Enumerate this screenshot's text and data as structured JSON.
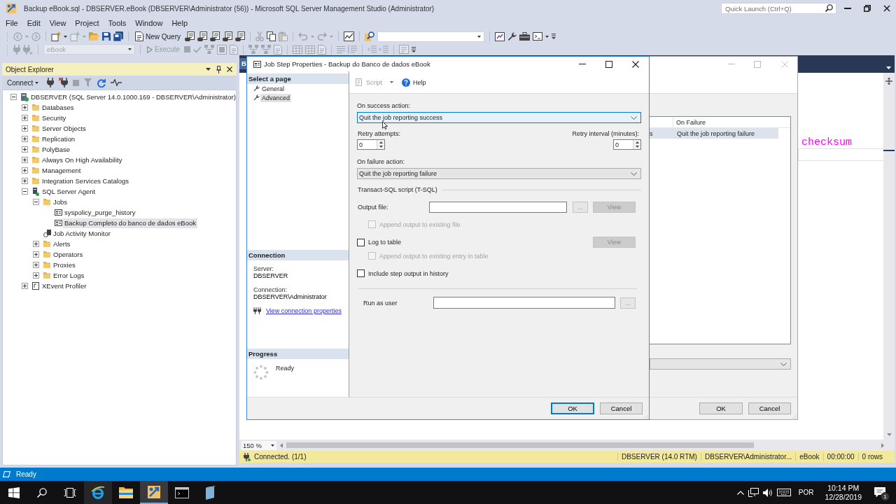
{
  "window": {
    "title": "Backup eBook.sql - DBSERVER.eBook (DBSERVER\\Administrator (56)) - Microsoft SQL Server Management Studio (Administrator)",
    "quick_launch": {
      "placeholder": "Quick Launch (Ctrl+Q)"
    }
  },
  "menu": [
    "File",
    "Edit",
    "View",
    "Project",
    "Tools",
    "Window",
    "Help"
  ],
  "toolbar_1": [
    {
      "kind": "back",
      "disabled": true
    },
    {
      "kind": "caret",
      "disabled": true
    },
    {
      "kind": "forward",
      "disabled": true
    },
    {
      "kind": "separator"
    },
    {
      "kind": "new_project",
      "disabled": false
    },
    {
      "kind": "caret",
      "disabled": false
    },
    {
      "kind": "add_item",
      "disabled": true
    },
    {
      "kind": "caret",
      "disabled": true
    },
    {
      "kind": "open",
      "disabled": false
    },
    {
      "kind": "save",
      "disabled": false
    },
    {
      "kind": "save_all",
      "disabled": false
    },
    {
      "kind": "separator"
    },
    {
      "kind": "new_query",
      "label": "New Query",
      "disabled": false
    },
    {
      "kind": "db_query",
      "disabled": false
    },
    {
      "kind": "db_query",
      "disabled": false
    },
    {
      "kind": "db_query",
      "disabled": false
    },
    {
      "kind": "db_query",
      "disabled": false
    },
    {
      "kind": "db_query",
      "disabled": false
    },
    {
      "kind": "separator"
    },
    {
      "kind": "cut",
      "disabled": true
    },
    {
      "kind": "copy",
      "disabled": false
    },
    {
      "kind": "paste",
      "disabled": true
    },
    {
      "kind": "separator"
    },
    {
      "kind": "undo",
      "disabled": true
    },
    {
      "kind": "caret",
      "disabled": true
    },
    {
      "kind": "redo",
      "disabled": true
    },
    {
      "kind": "caret",
      "disabled": true
    },
    {
      "kind": "separator"
    },
    {
      "kind": "activity",
      "disabled": false
    },
    {
      "kind": "separator"
    },
    {
      "kind": "find",
      "disabled": false
    },
    {
      "kind": "find_combo",
      "disabled": false
    },
    {
      "kind": "separator"
    },
    {
      "kind": "report",
      "disabled": false
    },
    {
      "kind": "wrench",
      "disabled": false
    },
    {
      "kind": "toolbox",
      "disabled": false
    },
    {
      "kind": "console",
      "disabled": false
    },
    {
      "kind": "caret",
      "disabled": false
    },
    {
      "kind": "overflow",
      "disabled": false
    }
  ],
  "toolbar_2": [
    {
      "kind": "plug",
      "disabled": true
    },
    {
      "kind": "plug_swap",
      "disabled": true
    },
    {
      "kind": "separator"
    },
    {
      "kind": "database_combo",
      "value": "eBook",
      "disabled": true
    },
    {
      "kind": "separator"
    },
    {
      "kind": "execute",
      "label": "Execute",
      "disabled": true
    },
    {
      "kind": "stop",
      "disabled": true
    },
    {
      "kind": "check",
      "disabled": true
    },
    {
      "kind": "plan",
      "disabled": true
    },
    {
      "kind": "query_box",
      "disabled": true
    },
    {
      "kind": "page",
      "disabled": true
    },
    {
      "kind": "separator"
    },
    {
      "kind": "plan",
      "disabled": true
    },
    {
      "kind": "plan",
      "disabled": true
    },
    {
      "kind": "page",
      "disabled": true
    },
    {
      "kind": "separator"
    },
    {
      "kind": "grid",
      "disabled": true
    },
    {
      "kind": "grid",
      "disabled": true
    },
    {
      "kind": "page",
      "disabled": true
    },
    {
      "kind": "separator"
    },
    {
      "kind": "lines",
      "disabled": true
    },
    {
      "kind": "comment",
      "disabled": true
    },
    {
      "kind": "separator"
    },
    {
      "kind": "outdent",
      "disabled": true
    },
    {
      "kind": "indent",
      "disabled": true
    },
    {
      "kind": "separator"
    },
    {
      "kind": "values",
      "disabled": true
    },
    {
      "kind": "overflow",
      "disabled": false
    }
  ],
  "object_explorer": {
    "title": "Object Explorer",
    "connect": "Connect",
    "toolbar": [
      {
        "kind": "plug",
        "disabled": false
      },
      {
        "kind": "plug_x",
        "disabled": false
      },
      {
        "kind": "stop",
        "disabled": true
      },
      {
        "kind": "filter",
        "disabled": true
      },
      {
        "kind": "refresh",
        "disabled": false
      },
      {
        "kind": "pulse",
        "disabled": false
      }
    ],
    "tree": [
      {
        "label": "DBSERVER (SQL Server 14.0.1000.169 - DBSERVER\\Administrator)",
        "kind": "server",
        "expanded": true,
        "selected": false,
        "children": [
          {
            "label": "Databases",
            "kind": "folder",
            "expanded": false,
            "selected": false
          },
          {
            "label": "Security",
            "kind": "folder",
            "expanded": false,
            "selected": false
          },
          {
            "label": "Server Objects",
            "kind": "folder",
            "expanded": false,
            "selected": false
          },
          {
            "label": "Replication",
            "kind": "folder",
            "expanded": false,
            "selected": false
          },
          {
            "label": "PolyBase",
            "kind": "folder",
            "expanded": false,
            "selected": false
          },
          {
            "label": "Always On High Availability",
            "kind": "folder",
            "expanded": false,
            "selected": false
          },
          {
            "label": "Management",
            "kind": "folder",
            "expanded": false,
            "selected": false
          },
          {
            "label": "Integration Services Catalogs",
            "kind": "folder",
            "expanded": false,
            "selected": false
          },
          {
            "label": "SQL Server Agent",
            "kind": "agent",
            "expanded": true,
            "selected": false,
            "children": [
              {
                "label": "Jobs",
                "kind": "folder",
                "expanded": true,
                "selected": false,
                "children": [
                  {
                    "label": "syspolicy_purge_history",
                    "kind": "job",
                    "selected": false
                  },
                  {
                    "label": "Backup Completo do banco de dados eBook",
                    "kind": "job",
                    "selected": true
                  }
                ]
              },
              {
                "label": "Job Activity Monitor",
                "kind": "monitor",
                "selected": false
              },
              {
                "label": "Alerts",
                "kind": "folder",
                "expanded": false,
                "selected": false
              },
              {
                "label": "Operators",
                "kind": "folder",
                "expanded": false,
                "selected": false
              },
              {
                "label": "Proxies",
                "kind": "folder",
                "expanded": false,
                "selected": false
              },
              {
                "label": "Error Logs",
                "kind": "folder",
                "expanded": false,
                "selected": false
              }
            ]
          },
          {
            "label": "XEvent Profiler",
            "kind": "profiler",
            "expanded": false,
            "selected": false
          }
        ]
      }
    ]
  },
  "editor": {
    "tab": "B",
    "code": "checksum",
    "zoom": "150 %",
    "status": {
      "message": "Connected. (1/1)",
      "fields": [
        "DBSERVER (14.0 RTM)",
        "DBSERVER\\Administrator...",
        "eBook",
        "00:00:00",
        "0 rows"
      ]
    }
  },
  "job_dialog": {
    "list": {
      "headings": {
        "on_failure": "On Failure"
      },
      "rows": [
        {
          "column_1": "s",
          "on_failure": "Quit the job reporting failure",
          "selected": true
        }
      ]
    },
    "buttons": [
      "OK",
      "Cancel"
    ]
  },
  "step_dialog": {
    "title": "Job Step Properties - Backup do Banco de dados eBook",
    "pages_header": "Select a page",
    "pages": [
      {
        "label": "General",
        "selected": false
      },
      {
        "label": "Advanced",
        "selected": true
      }
    ],
    "connection": {
      "header": "Connection",
      "server_label": "Server:",
      "server": "DBSERVER",
      "connection_label": "Connection:",
      "connection": "DBSERVER\\Administrator",
      "link": "View connection properties"
    },
    "progress": {
      "header": "Progress",
      "status": "Ready"
    },
    "toolbar": {
      "script": {
        "label": "Script",
        "disabled": true
      },
      "help": {
        "label": "Help",
        "disabled": false
      }
    },
    "on_success": {
      "label": "On success action:",
      "value": "Quit the job reporting success",
      "focused": true
    },
    "retry_attempts": {
      "label": "Retry attempts:",
      "value": "0"
    },
    "retry_interval": {
      "label": "Retry interval (minutes):",
      "value": "0"
    },
    "on_failure": {
      "label": "On failure action:",
      "value": "Quit the job reporting failure",
      "focused": false
    },
    "tsql_group": "Transact-SQL script (T-SQL)",
    "output_file": {
      "label": "Output file:",
      "browse": {
        "label": "...",
        "disabled": true
      },
      "view": {
        "label": "View",
        "disabled": true
      },
      "children": [
        {
          "label": "Append output to existing file",
          "checked": false,
          "disabled": true
        }
      ]
    },
    "log_to_table": {
      "label": "Log to table",
      "checked": false,
      "disabled": false,
      "view": {
        "label": "View",
        "disabled": true
      },
      "children": [
        {
          "label": "Append output to existing entry in table",
          "checked": false,
          "disabled": true
        }
      ]
    },
    "include_history": {
      "label": "Include step output in history",
      "checked": false,
      "disabled": false
    },
    "run_as_user": {
      "label": "Run as user",
      "browse": {
        "label": "...",
        "disabled": true
      }
    },
    "buttons": [
      {
        "label": "OK",
        "default": true
      },
      {
        "label": "Cancel",
        "default": false
      }
    ]
  },
  "app_status": "Ready",
  "taskbar": {
    "apps": [
      {
        "kind": "browser",
        "selected": false,
        "hovered": true
      },
      {
        "kind": "files",
        "selected": false,
        "hovered": false
      },
      {
        "kind": "ssms",
        "selected": true,
        "hovered": false
      },
      {
        "kind": "terminal",
        "selected": false,
        "hovered": false
      },
      {
        "kind": "notebook",
        "selected": false,
        "hovered": false
      }
    ],
    "language": "POR",
    "time": "10:14 PM",
    "date": "12/28/2019",
    "notifications": "1"
  }
}
